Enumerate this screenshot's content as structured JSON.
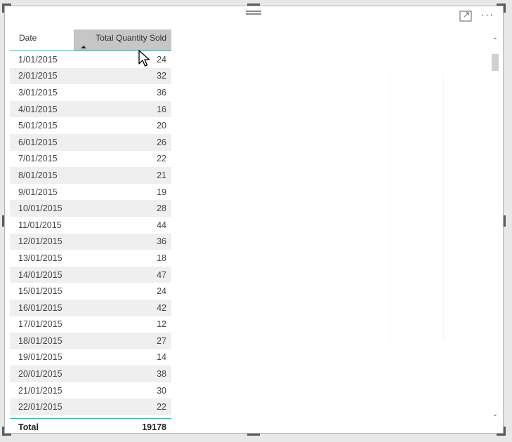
{
  "visual": {
    "more_label": "···",
    "table": {
      "headers": {
        "date": "Date",
        "total_quantity_sold": "Total Quantity Sold"
      },
      "sorted_column": "Total Quantity Sold",
      "sort_direction": "ascending",
      "rows": [
        {
          "date": "1/01/2015",
          "qty": "24"
        },
        {
          "date": "2/01/2015",
          "qty": "32"
        },
        {
          "date": "3/01/2015",
          "qty": "36"
        },
        {
          "date": "4/01/2015",
          "qty": "16"
        },
        {
          "date": "5/01/2015",
          "qty": "20"
        },
        {
          "date": "6/01/2015",
          "qty": "26"
        },
        {
          "date": "7/01/2015",
          "qty": "22"
        },
        {
          "date": "8/01/2015",
          "qty": "21"
        },
        {
          "date": "9/01/2015",
          "qty": "19"
        },
        {
          "date": "10/01/2015",
          "qty": "28"
        },
        {
          "date": "11/01/2015",
          "qty": "44"
        },
        {
          "date": "12/01/2015",
          "qty": "36"
        },
        {
          "date": "13/01/2015",
          "qty": "18"
        },
        {
          "date": "14/01/2015",
          "qty": "47"
        },
        {
          "date": "15/01/2015",
          "qty": "24"
        },
        {
          "date": "16/01/2015",
          "qty": "42"
        },
        {
          "date": "17/01/2015",
          "qty": "12"
        },
        {
          "date": "18/01/2015",
          "qty": "27"
        },
        {
          "date": "19/01/2015",
          "qty": "14"
        },
        {
          "date": "20/01/2015",
          "qty": "38"
        },
        {
          "date": "21/01/2015",
          "qty": "30"
        },
        {
          "date": "22/01/2015",
          "qty": "22"
        }
      ],
      "total": {
        "label": "Total",
        "value": "19178"
      }
    },
    "icons": {
      "grip": "drag-grip-icon",
      "focus": "focus-mode-icon",
      "more": "more-options-icon",
      "cursor": "mouse-pointer-icon"
    },
    "colors": {
      "accent": "#3fb4a9",
      "header_selected": "#c6c6c6",
      "row_alt": "#efeff0"
    }
  }
}
